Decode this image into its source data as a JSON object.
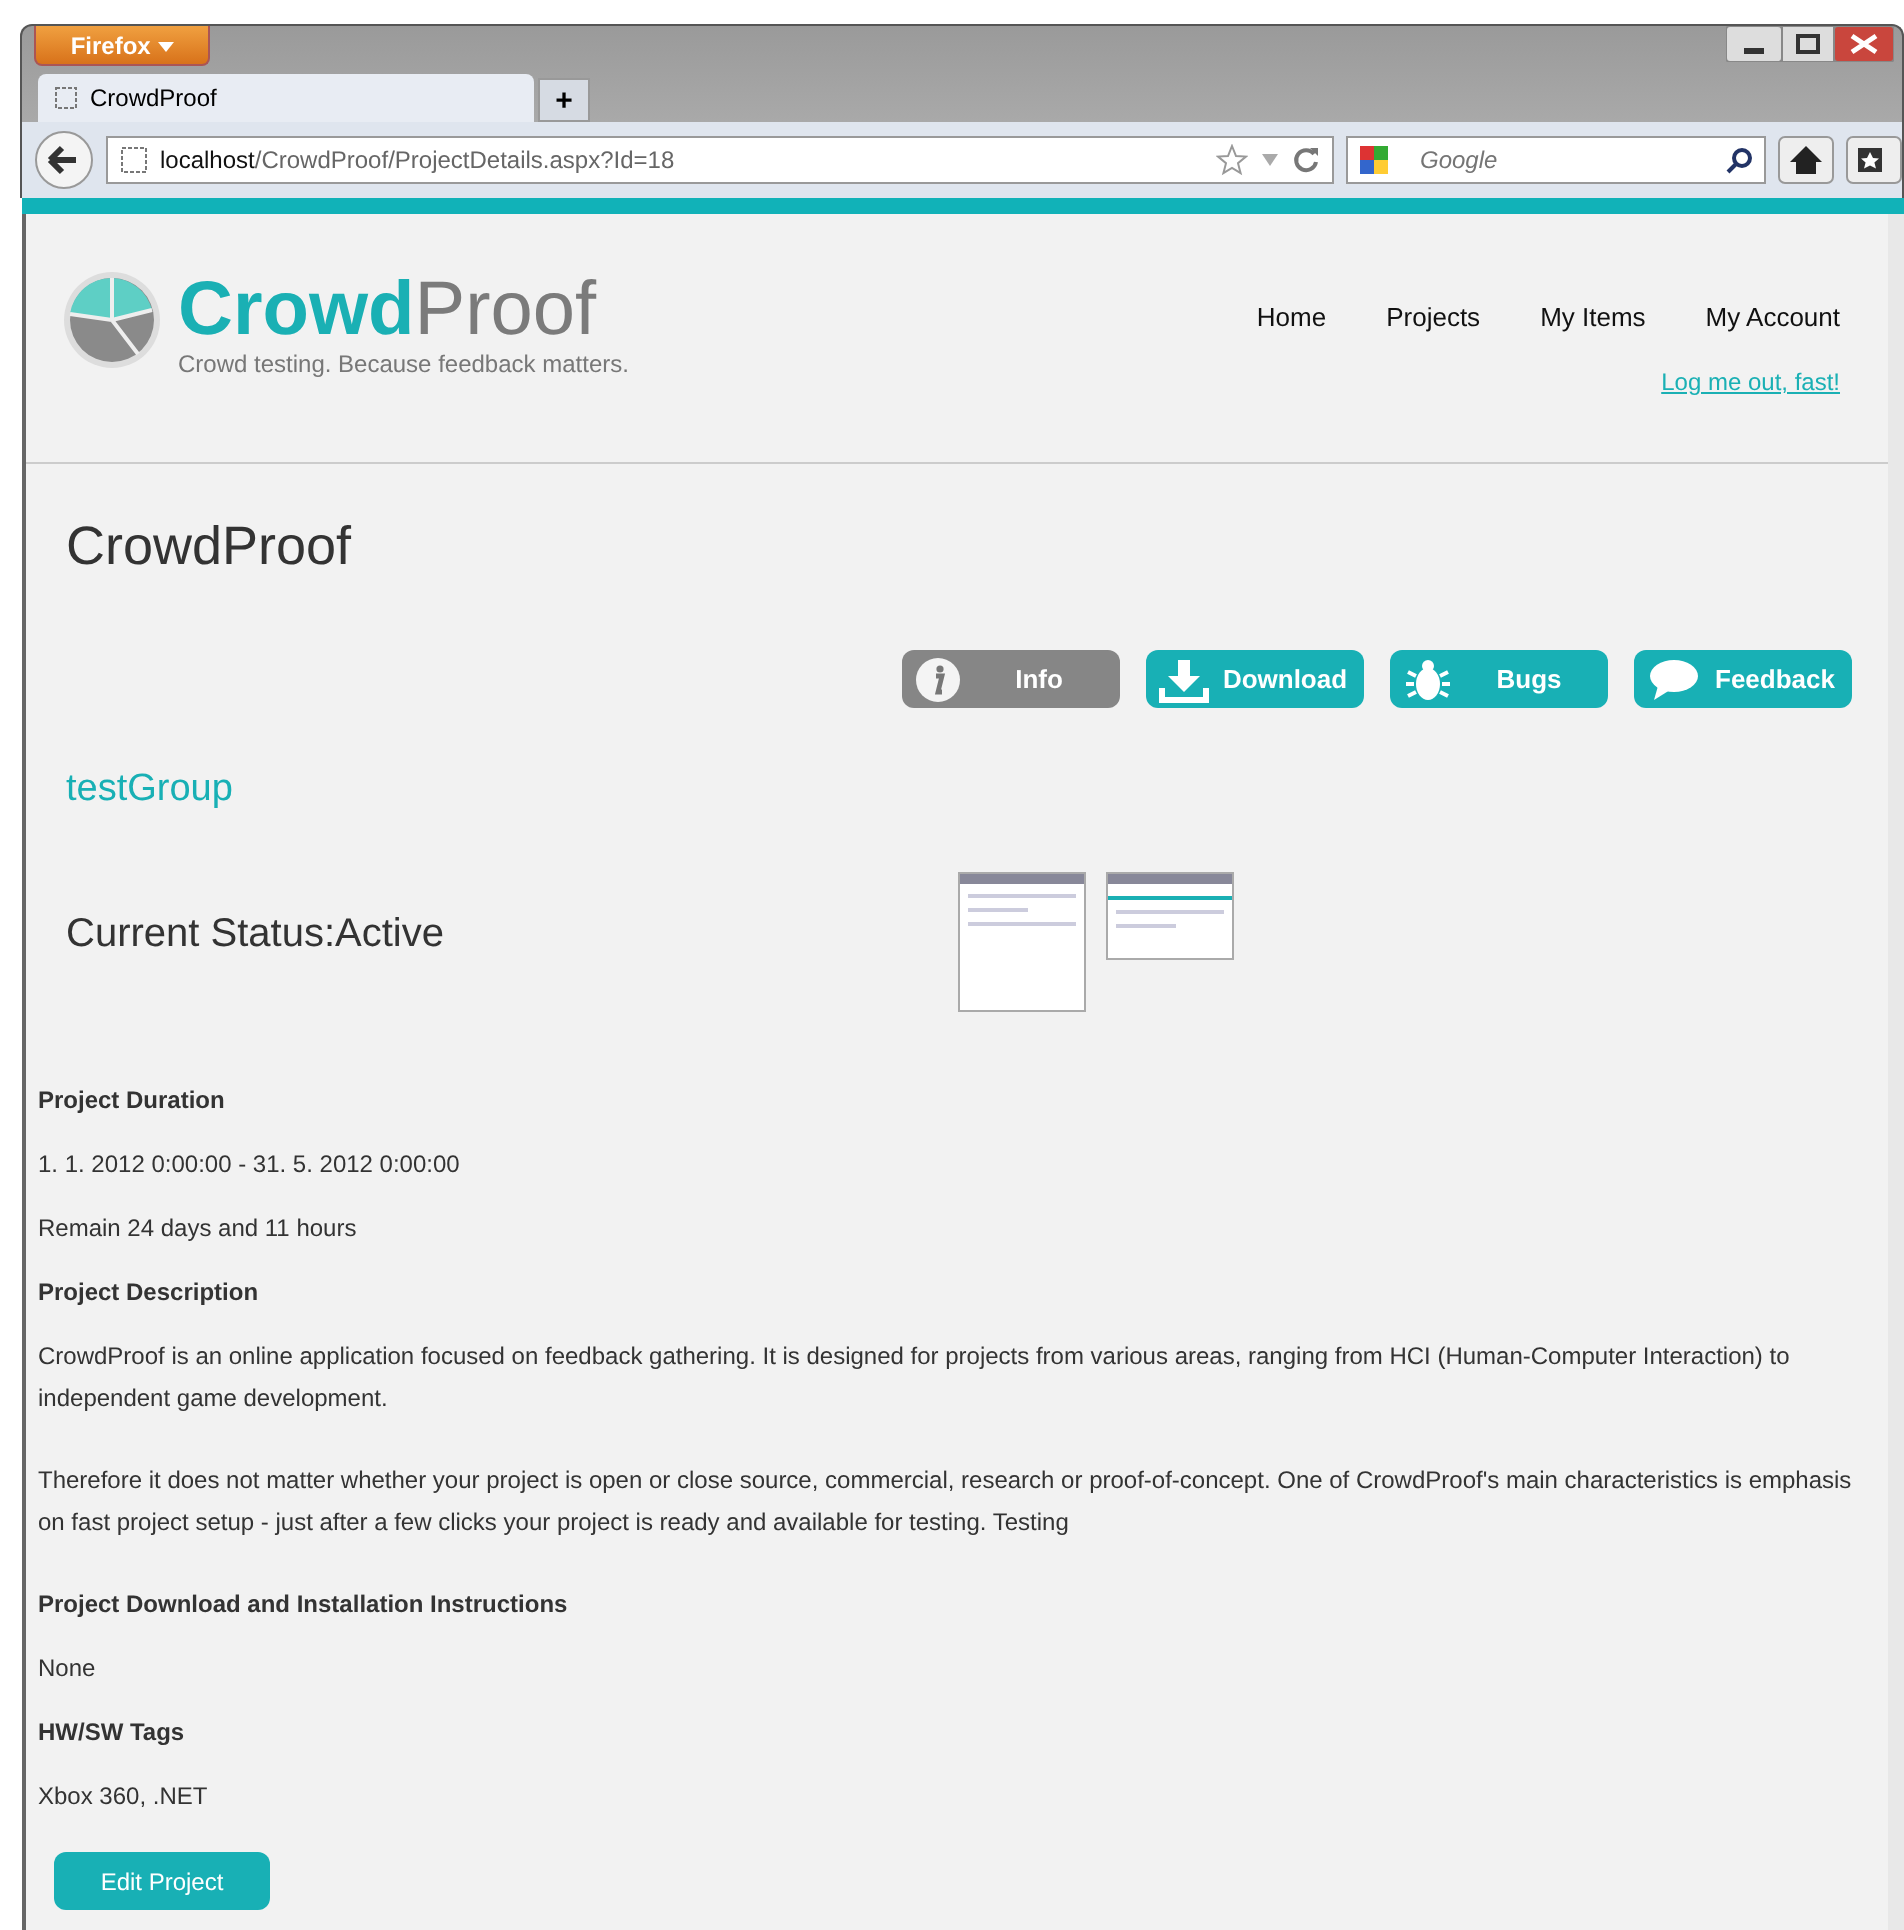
{
  "browser": {
    "menu_button": "Firefox",
    "tab_title": "CrowdProof",
    "new_tab": "+",
    "url_host": "localhost",
    "url_path": "/CrowdProof/ProjectDetails.aspx?Id=18",
    "search_placeholder": "Google"
  },
  "header": {
    "logo_a": "Crowd",
    "logo_b": "Proof",
    "tagline": "Crowd testing. Because feedback matters.",
    "nav": [
      {
        "label": "Home"
      },
      {
        "label": "Projects"
      },
      {
        "label": "My Items"
      },
      {
        "label": "My Account"
      }
    ],
    "logout": "Log me out, fast!"
  },
  "project": {
    "title": "CrowdProof",
    "tabs": [
      {
        "label": "Info",
        "kind": "info",
        "selected": true
      },
      {
        "label": "Download",
        "kind": "download",
        "selected": false
      },
      {
        "label": "Bugs",
        "kind": "bugs",
        "selected": false
      },
      {
        "label": "Feedback",
        "kind": "feedback",
        "selected": false
      }
    ],
    "group": "testGroup",
    "status": "Current Status:Active"
  },
  "details": [
    {
      "kind": "heading",
      "text": "Project Duration"
    },
    {
      "kind": "text",
      "text": "1. 1. 2012 0:00:00 - 31. 5. 2012 0:00:00"
    },
    {
      "kind": "text",
      "text": "Remain 24 days and 11 hours"
    },
    {
      "kind": "heading",
      "text": "Project Description"
    },
    {
      "kind": "para",
      "text": "CrowdProof is an online application focused on feedback gathering. It is designed for projects from various areas, ranging from HCI (Human-Computer Interaction) to independent game development."
    },
    {
      "kind": "para",
      "text": "Therefore it does not matter whether your project is open or close source, commercial, research or proof-of-concept. One of CrowdProof's main characteristics is emphasis on fast project setup - just after a few clicks your project is ready and available for testing. Testing"
    },
    {
      "kind": "heading",
      "text": "Project Download and Installation Instructions"
    },
    {
      "kind": "text",
      "text": "None"
    },
    {
      "kind": "heading",
      "text": "HW/SW Tags"
    },
    {
      "kind": "text",
      "text": "Xbox 360, .NET"
    }
  ],
  "edit_button": "Edit Project"
}
